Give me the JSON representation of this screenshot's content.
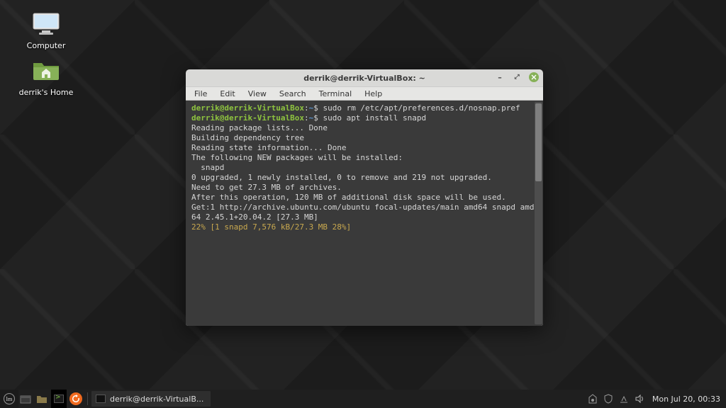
{
  "desktop": {
    "computer_label": "Computer",
    "home_label": "derrik's Home"
  },
  "window": {
    "title": "derrik@derrik-VirtualBox: ~",
    "menu": {
      "file": "File",
      "edit": "Edit",
      "view": "View",
      "search": "Search",
      "terminal": "Terminal",
      "help": "Help"
    }
  },
  "term": {
    "user": "derrik@derrik-VirtualBox",
    "path": "~",
    "prompt": "$",
    "cmd1": "sudo rm /etc/apt/preferences.d/nosnap.pref",
    "cmd2": "sudo apt install snapd",
    "out": [
      "Reading package lists... Done",
      "Building dependency tree",
      "Reading state information... Done",
      "The following NEW packages will be installed:",
      "  snapd",
      "0 upgraded, 1 newly installed, 0 to remove and 219 not upgraded.",
      "Need to get 27.3 MB of archives.",
      "After this operation, 120 MB of additional disk space will be used.",
      "Get:1 http://archive.ubuntu.com/ubuntu focal-updates/main amd64 snapd amd64 2.45.1+20.04.2 [27.3 MB]"
    ],
    "progress": "22% [1 snapd 7,576 kB/27.3 MB 28%]"
  },
  "taskbar": {
    "active_window": "derrik@derrik-VirtualB...",
    "clock": "Mon Jul 20, 00:33"
  }
}
